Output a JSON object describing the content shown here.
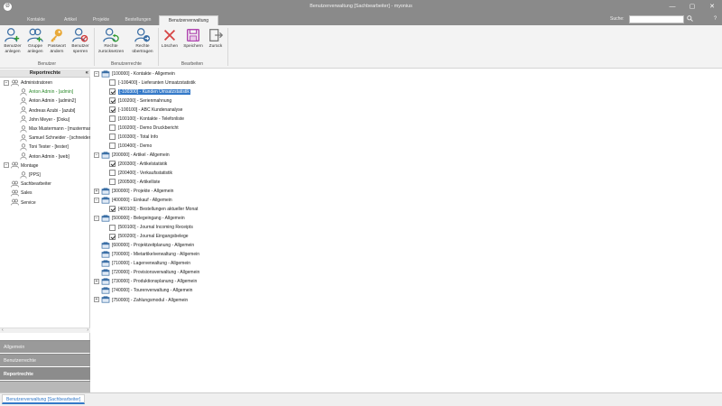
{
  "window": {
    "title": "Benutzerverwaltung [Sachbearbeiter] - myonius",
    "logo": "Ø",
    "buttons": {
      "minimize": "—",
      "maximize": "▢",
      "close": "✕"
    }
  },
  "tabs": [
    {
      "label": "Kontakte"
    },
    {
      "label": "Artikel"
    },
    {
      "label": "Projekte"
    },
    {
      "label": "Bestellungen"
    },
    {
      "label": "Benutzerverwaltung",
      "active": true
    }
  ],
  "search": {
    "label": "Suche:",
    "value": "",
    "search_icon": "search-icon",
    "help": "?"
  },
  "ribbon": {
    "groups": [
      {
        "label": "Benutzer",
        "buttons": [
          {
            "label1": "Benutzer",
            "label2": "anlegen",
            "icon": "user-add-icon"
          },
          {
            "label1": "Gruppe",
            "label2": "anlegen",
            "icon": "group-add-icon"
          },
          {
            "label1": "Passwort",
            "label2": "ändern",
            "icon": "key-icon"
          },
          {
            "label1": "Benutzer",
            "label2": "sperren",
            "icon": "user-lock-icon"
          }
        ]
      },
      {
        "label": "Benutzerrechte",
        "buttons": [
          {
            "label1": "Rechte",
            "label2": "zurücksetzen",
            "icon": "rights-reset-icon"
          },
          {
            "label1": "Rechte",
            "label2": "übertragen",
            "icon": "rights-transfer-icon"
          }
        ]
      },
      {
        "label": "Bearbeiten",
        "buttons": [
          {
            "label1": "Löschen",
            "label2": "",
            "icon": "delete-icon"
          },
          {
            "label1": "Speichern",
            "label2": "",
            "icon": "save-icon"
          },
          {
            "label1": "Zurück",
            "label2": "",
            "icon": "back-icon"
          }
        ]
      }
    ]
  },
  "left_panel": {
    "title": "Reportrechte",
    "collapse": "«",
    "tree": [
      {
        "label": "Administratoren",
        "type": "group",
        "expander": "−"
      },
      {
        "label": "Anton Admin - [admin]",
        "type": "user",
        "green": true
      },
      {
        "label": "Anton Admin - [admin2]",
        "type": "user"
      },
      {
        "label": "Andreas Azubi - [azubi]",
        "type": "user"
      },
      {
        "label": "John Meyer - [Doku]",
        "type": "user"
      },
      {
        "label": "Max Mustermann - [mustermann]",
        "type": "user"
      },
      {
        "label": "Samuel Schneider - [schneider]",
        "type": "user"
      },
      {
        "label": "Toni Tester - [tester]",
        "type": "user"
      },
      {
        "label": "Anton Admin - [web]",
        "type": "user"
      },
      {
        "label": "Montage",
        "type": "group",
        "expander": "−"
      },
      {
        "label": "[PPS]",
        "type": "user"
      },
      {
        "label": "Sachbearbeiter",
        "type": "group"
      },
      {
        "label": "Sales",
        "type": "group"
      },
      {
        "label": "Service",
        "type": "group"
      }
    ],
    "scroll_left": "‹",
    "scroll_right": "›",
    "nav": [
      {
        "label": "Allgemein"
      },
      {
        "label": "Benutzerrechte"
      },
      {
        "label": "Reportrechte",
        "active": true
      }
    ]
  },
  "main_tree": [
    {
      "label": "[100000] - Kontakte - Allgemein",
      "level": 0,
      "expander": "−",
      "category": true
    },
    {
      "label": "[-100400] - Lieferanten Umsatzstatistik",
      "level": 1,
      "checked": false
    },
    {
      "label": "[-100300] - Kunden Umsatzstatistik",
      "level": 1,
      "checked": true,
      "selected": true
    },
    {
      "label": "[100200] - Serienmahnung",
      "level": 1,
      "checked": true
    },
    {
      "label": "[-100100] - ABC Kundenanalyse",
      "level": 1,
      "checked": true
    },
    {
      "label": "[100100] - Kontakte - Telefonliste",
      "level": 1,
      "checked": false
    },
    {
      "label": "[100200] - Demo Druckbericht",
      "level": 1,
      "checked": false
    },
    {
      "label": "[100300] - Total Info",
      "level": 1,
      "checked": false
    },
    {
      "label": "[100400] - Demo",
      "level": 1,
      "checked": false
    },
    {
      "label": "[200000] - Artikel - Allgemein",
      "level": 0,
      "expander": "−",
      "category": true
    },
    {
      "label": "[200300] - Artikelstatistik",
      "level": 1,
      "checked": true
    },
    {
      "label": "[200400] - Verkaufsstatistik",
      "level": 1,
      "checked": false
    },
    {
      "label": "[200500] - Artikelliste",
      "level": 1,
      "checked": false
    },
    {
      "label": "[300000] - Projekte - Allgemein",
      "level": 0,
      "expander": "+",
      "category": true
    },
    {
      "label": "[400000] - Einkauf - Allgemein",
      "level": 0,
      "expander": "−",
      "category": true
    },
    {
      "label": "[400100] - Bestellungen aktueller Monat",
      "level": 1,
      "checked": true
    },
    {
      "label": "[500000] - Belegeingang - Allgemein",
      "level": 0,
      "expander": "−",
      "category": true
    },
    {
      "label": "[500100] - Journal Incoming Receipts",
      "level": 1,
      "checked": false
    },
    {
      "label": "[500200] - Journal Eingangsbelege",
      "level": 1,
      "checked": true
    },
    {
      "label": "[600000] - Projektzeitplanung - Allgemein",
      "level": 0,
      "category": true
    },
    {
      "label": "[700000] - Mietartikelverwaltung - Allgemein",
      "level": 0,
      "category": true
    },
    {
      "label": "[710000] - Lagerverwaltung - Allgemein",
      "level": 0,
      "category": true
    },
    {
      "label": "[720000] - Provisionsverwaltung - Allgemein",
      "level": 0,
      "category": true
    },
    {
      "label": "[730000] - Produktionsplanung - Allgemein",
      "level": 0,
      "expander": "+",
      "category": true
    },
    {
      "label": "[740000] - Tourenverwaltung - Allgemein",
      "level": 0,
      "category": true
    },
    {
      "label": "[750000] - Zahlungsmodul - Allgemein",
      "level": 0,
      "expander": "+",
      "category": true
    }
  ],
  "statusbar": {
    "tab_label": "Benutzerverwaltung [Sachbearbeiter]"
  },
  "colors": {
    "accent": "#3479c8",
    "chrome": "#8a8a8a",
    "green_user": "#2e8b2e"
  }
}
